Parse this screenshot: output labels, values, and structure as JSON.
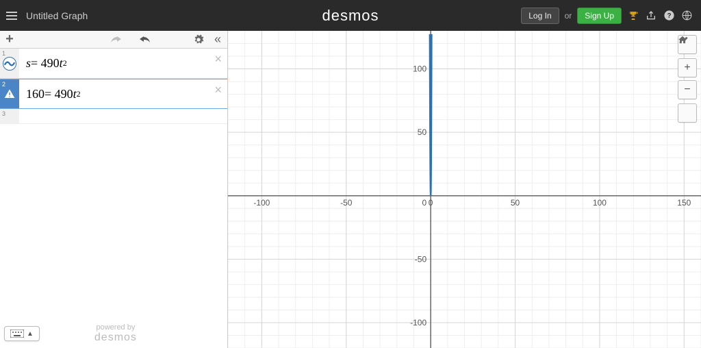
{
  "header": {
    "title": "Untitled Graph",
    "brand": "desmos",
    "login": "Log In",
    "or": "or",
    "signup": "Sign Up"
  },
  "toolbar": {
    "add": "+",
    "undo": "↶",
    "redo": "↷",
    "settings": "⚙",
    "collapse": "«"
  },
  "expressions": [
    {
      "index": "1",
      "type": "plot",
      "var": "s",
      "eq": " = 490",
      "tvar": "t",
      "exp": "2"
    },
    {
      "index": "2",
      "type": "warn",
      "lhs": "160",
      "eq": " = 490",
      "tvar": "t",
      "exp": "2"
    }
  ],
  "row3_index": "3",
  "footer": {
    "powered": "powered by",
    "brand": "desmos"
  },
  "graph_controls": {
    "wrench": "🔧",
    "plus": "+",
    "minus": "−",
    "home": "⌂"
  },
  "chart_data": {
    "type": "line",
    "title": "",
    "xlabel": "",
    "ylabel": "",
    "xlim": [
      -120,
      160
    ],
    "ylim": [
      -120,
      130
    ],
    "xticks": [
      -100,
      -50,
      0,
      50,
      100,
      150
    ],
    "yticks": [
      -100,
      -50,
      50,
      100
    ],
    "series": [
      {
        "name": "s = 490t^2",
        "color": "#2d70b3",
        "x": [
          -0.51,
          -0.4,
          -0.3,
          -0.2,
          -0.1,
          0,
          0.1,
          0.2,
          0.3,
          0.4,
          0.51
        ],
        "y": [
          127.4,
          78.4,
          44.1,
          19.6,
          4.9,
          0,
          4.9,
          19.6,
          44.1,
          78.4,
          127.4
        ]
      }
    ]
  }
}
